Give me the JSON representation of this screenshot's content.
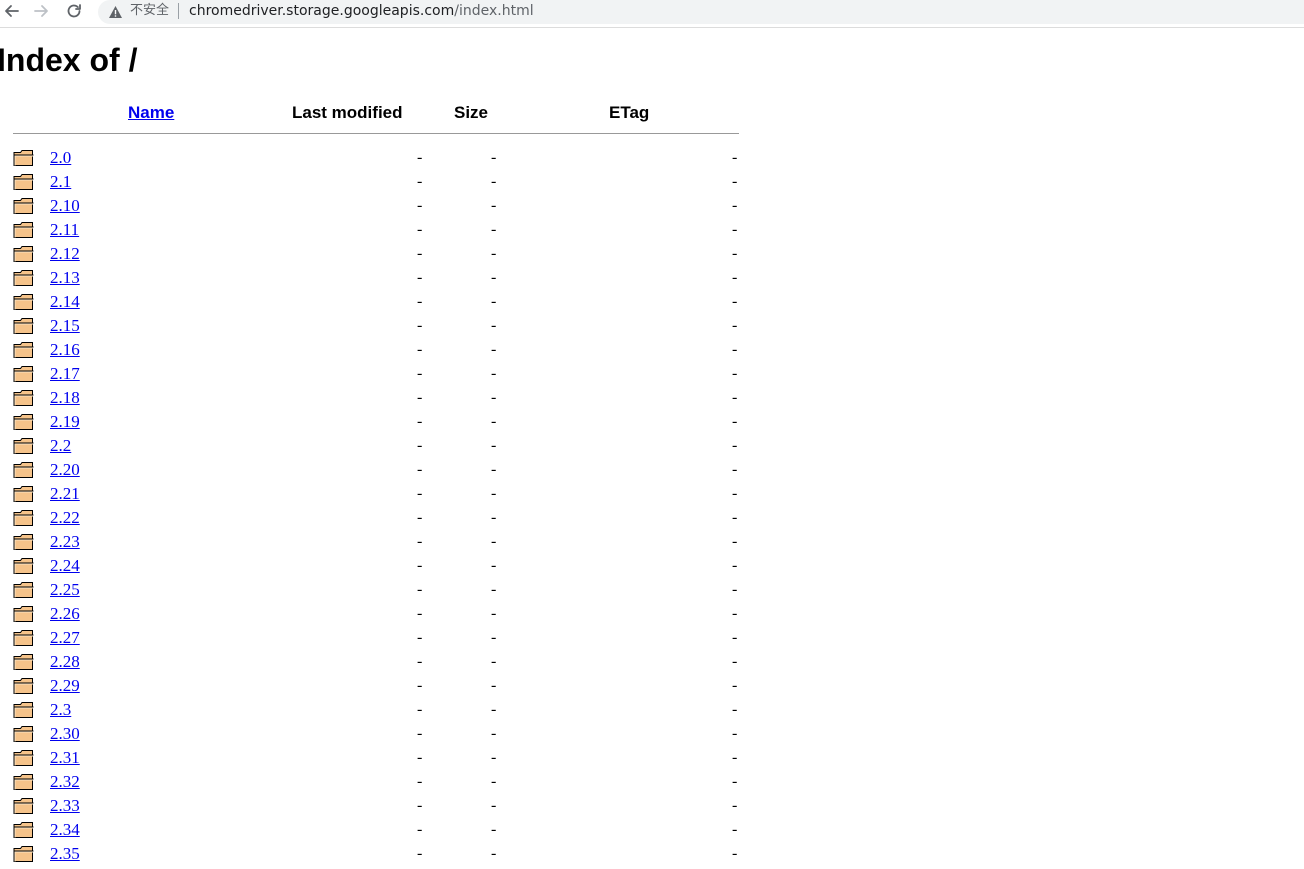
{
  "browser": {
    "insecure_label": "不安全",
    "url_host": "chromedriver.storage.googleapis.com",
    "url_path": "/index.html"
  },
  "page": {
    "title": "Index of /"
  },
  "table": {
    "headers": {
      "name": "Name",
      "last_modified": "Last modified",
      "size": "Size",
      "etag": "ETag"
    },
    "rows": [
      {
        "name": "2.0",
        "last_modified": "-",
        "size": "-",
        "etag": "-"
      },
      {
        "name": "2.1",
        "last_modified": "-",
        "size": "-",
        "etag": "-"
      },
      {
        "name": "2.10",
        "last_modified": "-",
        "size": "-",
        "etag": "-"
      },
      {
        "name": "2.11",
        "last_modified": "-",
        "size": "-",
        "etag": "-"
      },
      {
        "name": "2.12",
        "last_modified": "-",
        "size": "-",
        "etag": "-"
      },
      {
        "name": "2.13",
        "last_modified": "-",
        "size": "-",
        "etag": "-"
      },
      {
        "name": "2.14",
        "last_modified": "-",
        "size": "-",
        "etag": "-"
      },
      {
        "name": "2.15",
        "last_modified": "-",
        "size": "-",
        "etag": "-"
      },
      {
        "name": "2.16",
        "last_modified": "-",
        "size": "-",
        "etag": "-"
      },
      {
        "name": "2.17",
        "last_modified": "-",
        "size": "-",
        "etag": "-"
      },
      {
        "name": "2.18",
        "last_modified": "-",
        "size": "-",
        "etag": "-"
      },
      {
        "name": "2.19",
        "last_modified": "-",
        "size": "-",
        "etag": "-"
      },
      {
        "name": "2.2",
        "last_modified": "-",
        "size": "-",
        "etag": "-"
      },
      {
        "name": "2.20",
        "last_modified": "-",
        "size": "-",
        "etag": "-"
      },
      {
        "name": "2.21",
        "last_modified": "-",
        "size": "-",
        "etag": "-"
      },
      {
        "name": "2.22",
        "last_modified": "-",
        "size": "-",
        "etag": "-"
      },
      {
        "name": "2.23",
        "last_modified": "-",
        "size": "-",
        "etag": "-"
      },
      {
        "name": "2.24",
        "last_modified": "-",
        "size": "-",
        "etag": "-"
      },
      {
        "name": "2.25",
        "last_modified": "-",
        "size": "-",
        "etag": "-"
      },
      {
        "name": "2.26",
        "last_modified": "-",
        "size": "-",
        "etag": "-"
      },
      {
        "name": "2.27",
        "last_modified": "-",
        "size": "-",
        "etag": "-"
      },
      {
        "name": "2.28",
        "last_modified": "-",
        "size": "-",
        "etag": "-"
      },
      {
        "name": "2.29",
        "last_modified": "-",
        "size": "-",
        "etag": "-"
      },
      {
        "name": "2.3",
        "last_modified": "-",
        "size": "-",
        "etag": "-"
      },
      {
        "name": "2.30",
        "last_modified": "-",
        "size": "-",
        "etag": "-"
      },
      {
        "name": "2.31",
        "last_modified": "-",
        "size": "-",
        "etag": "-"
      },
      {
        "name": "2.32",
        "last_modified": "-",
        "size": "-",
        "etag": "-"
      },
      {
        "name": "2.33",
        "last_modified": "-",
        "size": "-",
        "etag": "-"
      },
      {
        "name": "2.34",
        "last_modified": "-",
        "size": "-",
        "etag": "-"
      },
      {
        "name": "2.35",
        "last_modified": "-",
        "size": "-",
        "etag": "-"
      }
    ]
  },
  "icons": {
    "back": "arrow-left-icon",
    "forward": "arrow-right-icon",
    "reload": "reload-icon",
    "warning": "warning-triangle-icon",
    "folder": "folder-icon"
  },
  "colors": {
    "link": "#0000ee",
    "folder_fill": "#f5c38a",
    "folder_outline": "#000000",
    "omnibox_bg": "#f1f3f4"
  }
}
